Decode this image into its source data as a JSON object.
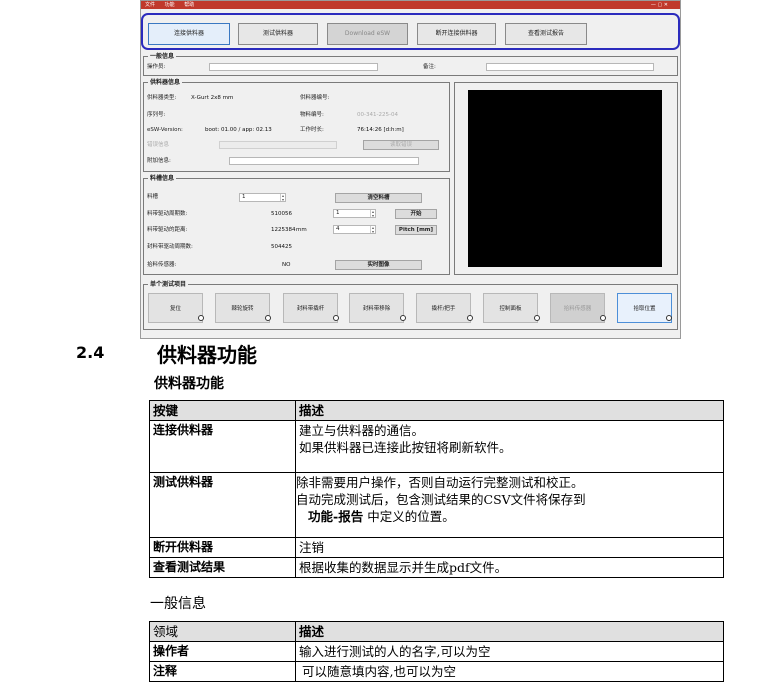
{
  "screenshot": {
    "titlebar": {
      "menu": [
        "文件",
        "功能",
        "帮助"
      ],
      "win": "— ▢ ✕"
    },
    "top_buttons": [
      "连接供料器",
      "测试供料器",
      "Download eSW",
      "断开连接供料器",
      "查看测试报告"
    ],
    "general": {
      "title": "一般信息",
      "operator_label": "操作员:",
      "comment_label": "备注:"
    },
    "feeder": {
      "title": "供料器信息",
      "rows": [
        {
          "l1": "供料器类型:",
          "v1": "X-Gurt 2x8 mm",
          "l2": "供料器编号:",
          "v2": ""
        },
        {
          "l1": "序列号:",
          "v1": "",
          "l2": "物料编号:",
          "v2": "00-341-225-04"
        },
        {
          "l1": "eSW-Version:",
          "v1": "boot: 01.00 / app: 02.13",
          "l2": "工作时长:",
          "v2": "76:14:26 [d:h:m]"
        },
        {
          "l1": "错误信息",
          "v1": "",
          "l2": "",
          "v2": ""
        },
        {
          "l1": "附加信息:",
          "v1": "",
          "l2": "",
          "v2": ""
        }
      ],
      "read_error_button": "读取错误"
    },
    "tray": {
      "title": "料槽信息",
      "rows": [
        {
          "label": "料槽",
          "value": "1",
          "unit": ""
        },
        {
          "label": "料带驱动周期数:",
          "value": "510056",
          "unit": ""
        },
        {
          "label": "料带驱动的距离:",
          "value": "1225384",
          "unit": "mm"
        },
        {
          "label": "封料带驱动周期数:",
          "value": "504425",
          "unit": ""
        },
        {
          "label": "拾料传感器:",
          "value": "NO",
          "unit": ""
        }
      ],
      "right_buttons": [
        "清空料槽",
        "开始",
        "Pitch [mm]",
        "实时图像"
      ],
      "spin_values": [
        "1",
        "4"
      ]
    },
    "single_test": {
      "title": "单个测试项目",
      "tiles": [
        "复位",
        "棘轮旋转",
        "封料带撬杆",
        "封料带移除",
        "撬杆/把手",
        "控制面板",
        "拾料传感器",
        "拾取位置"
      ]
    }
  },
  "section": {
    "number": "2.4",
    "title": "供料器功能",
    "subtitle": "供料器功能",
    "table": {
      "headers": [
        "按键",
        "描述"
      ],
      "rows": [
        {
          "key": "连接供料器",
          "desc": [
            "建立与供料器的通信。",
            "如果供料器已连接此按钮将刷新软件。"
          ]
        },
        {
          "key": "测试供料器",
          "desc": [
            "除非需要用户操作，否则自动运行完整测试和校正。",
            "自动完成测试后，包含测试结果的CSV文件将保存到"
          ],
          "desc_strong": "功能-报告",
          "desc_tail": "中定义的位置。"
        },
        {
          "key": "断开供料器",
          "desc": [
            "注销"
          ]
        },
        {
          "key": "查看测试结果",
          "desc": [
            "根据收集的数据显示并生成pdf文件。"
          ]
        }
      ]
    },
    "subtitle2": "一般信息",
    "table2": {
      "headers": [
        "领域",
        "描述"
      ],
      "rows": [
        {
          "key": "操作者",
          "desc": "输入进行测试的人的名字,可以为空"
        },
        {
          "key": "注释",
          "desc": "可以随意填内容,也可以为空"
        }
      ]
    }
  }
}
